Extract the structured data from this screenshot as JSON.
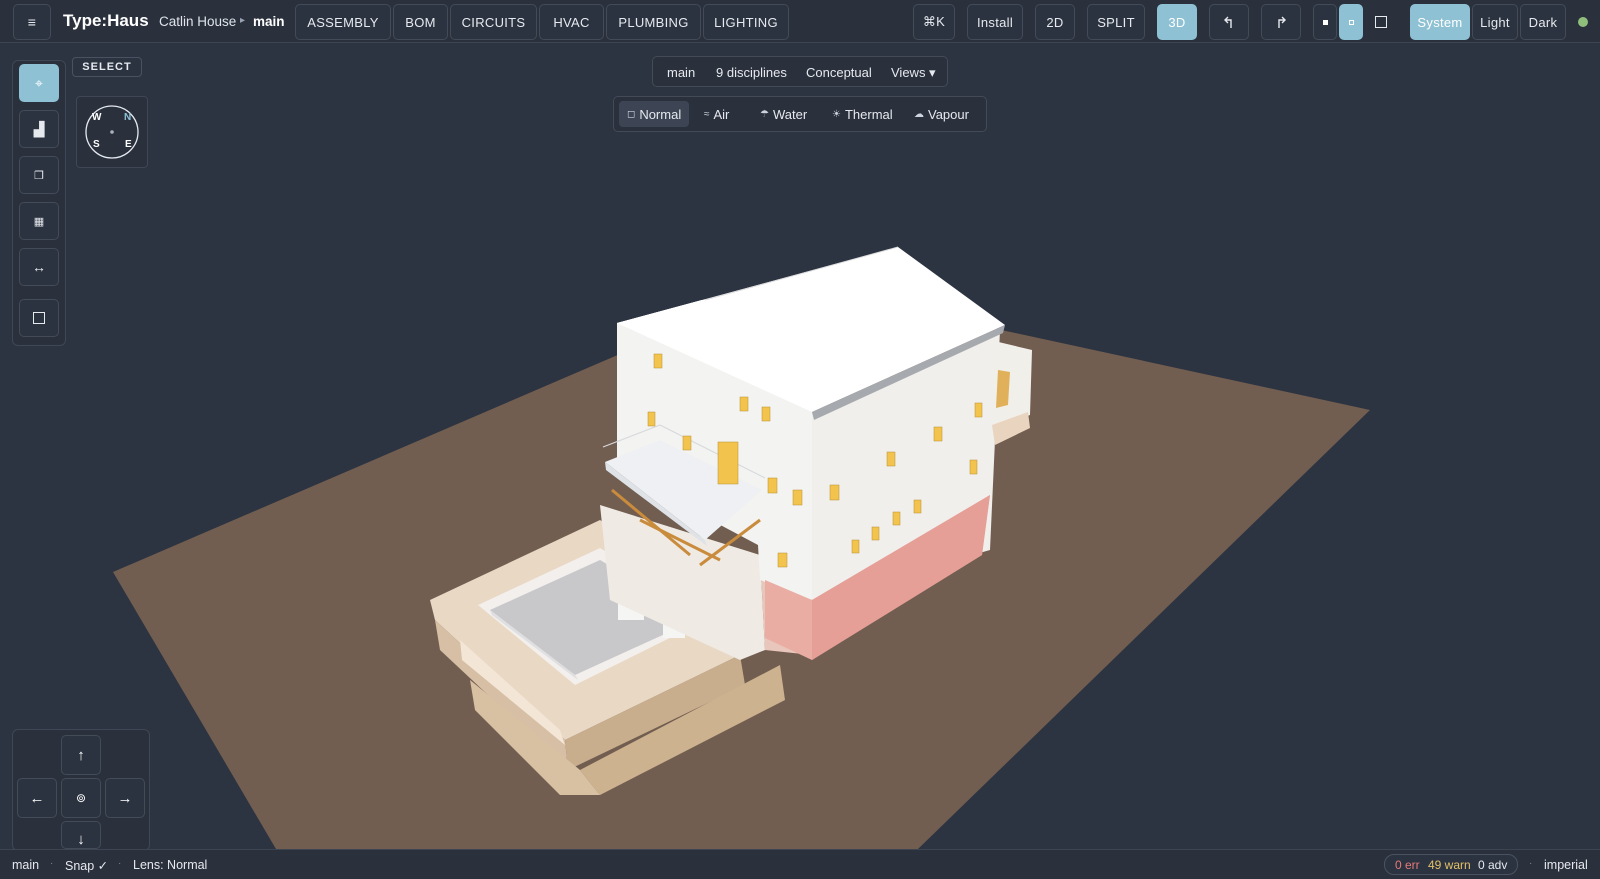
{
  "app": {
    "menu_icon": "hamburger-icon",
    "brand": "Type:Haus",
    "project": "Catlin House",
    "branch": "main"
  },
  "nav_tabs": [
    "ASSEMBLY",
    "BOM",
    "CIRCUITS",
    "HVAC",
    "PLUMBING",
    "LIGHTING"
  ],
  "toolbar": {
    "command": "⌘K",
    "install": "Install",
    "view_modes": [
      "2D",
      "SPLIT",
      "3D"
    ],
    "active_view_mode": "3D",
    "undo_icon": "undo-icon",
    "redo_icon": "redo-icon",
    "density_icons": [
      "small-dot-icon",
      "medium-dot-icon",
      "square-icon"
    ],
    "active_density": 1,
    "themes": [
      "System",
      "Light",
      "Dark"
    ],
    "active_theme": "System",
    "status_color": "#8fbf7a"
  },
  "tool_panel": {
    "mode_label": "SELECT",
    "tools": [
      "select-tool-icon",
      "stair-tool-icon",
      "copy-tool-icon",
      "fill-tool-icon",
      "measure-tool-icon",
      "rectangle-tool-icon"
    ],
    "active_tool": 0
  },
  "compass": {
    "w": "W",
    "n": "N",
    "s": "S",
    "e": "E"
  },
  "info_bar": {
    "branch": "main",
    "disciplines": "9 disciplines",
    "stage": "Conceptual",
    "views": "Views ▾"
  },
  "lenses": [
    {
      "icon": "◻",
      "label": "Normal",
      "active": true
    },
    {
      "icon": "≈",
      "label": "Air",
      "active": false
    },
    {
      "icon": "☂",
      "label": "Water",
      "active": false
    },
    {
      "icon": "☀",
      "label": "Thermal",
      "active": false
    },
    {
      "icon": "☁",
      "label": "Vapour",
      "active": false
    }
  ],
  "nav_pad": {
    "up": "↑",
    "left": "←",
    "center": "⊚",
    "right": "→",
    "down": "↓"
  },
  "status": {
    "branch": "main",
    "snap": "Snap ✓",
    "lens": "Lens: Normal",
    "errors": "0 err",
    "warnings": "49 warn",
    "advisories": "0 adv",
    "units": "imperial",
    "error_color": "#e57a7a",
    "warning_color": "#e3c06a"
  },
  "colors": {
    "background": "#2c3341",
    "ground": "#725e50",
    "accent": "#8ec1d4",
    "walls": "#f5f5f3",
    "foundation": "#e8a8a0"
  }
}
